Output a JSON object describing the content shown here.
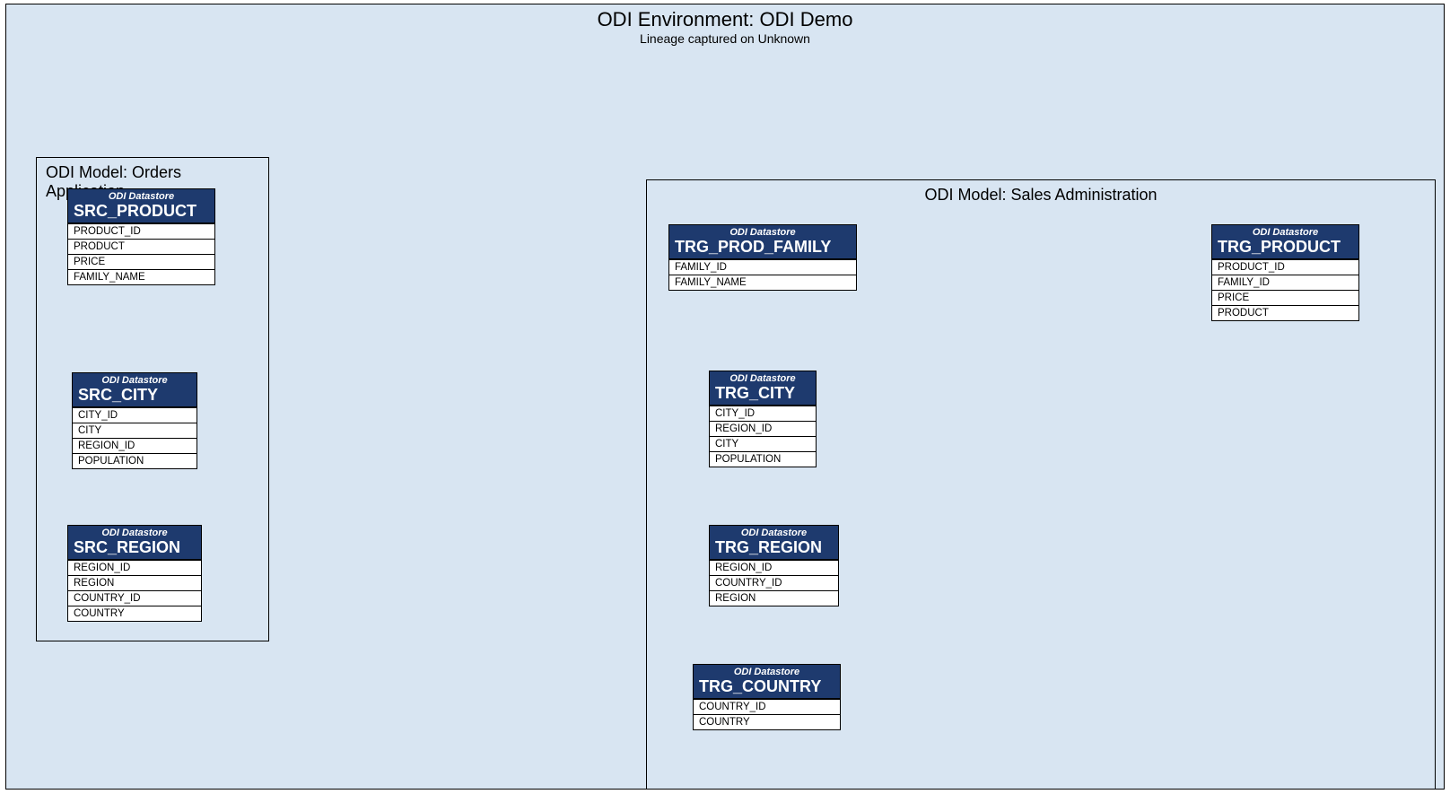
{
  "env": {
    "title": "ODI Environment: ODI Demo",
    "subtitle": "Lineage captured on Unknown"
  },
  "models": {
    "orders": {
      "title": "ODI Model: Orders Application"
    },
    "sales": {
      "title": "ODI Model: Sales Administration"
    }
  },
  "ds_label": "ODI Datastore",
  "tables": {
    "src_product": {
      "name": "SRC_PRODUCT",
      "cols": [
        "PRODUCT_ID",
        "PRODUCT",
        "PRICE",
        "FAMILY_NAME"
      ]
    },
    "src_city": {
      "name": "SRC_CITY",
      "cols": [
        "CITY_ID",
        "CITY",
        "REGION_ID",
        "POPULATION"
      ]
    },
    "src_region": {
      "name": "SRC_REGION",
      "cols": [
        "REGION_ID",
        "REGION",
        "COUNTRY_ID",
        "COUNTRY"
      ]
    },
    "trg_pf": {
      "name": "TRG_PROD_FAMILY",
      "cols": [
        "FAMILY_ID",
        "FAMILY_NAME"
      ]
    },
    "trg_city": {
      "name": "TRG_CITY",
      "cols": [
        "CITY_ID",
        "REGION_ID",
        "CITY",
        "POPULATION"
      ]
    },
    "trg_region": {
      "name": "TRG_REGION",
      "cols": [
        "REGION_ID",
        "COUNTRY_ID",
        "REGION"
      ]
    },
    "trg_country": {
      "name": "TRG_COUNTRY",
      "cols": [
        "COUNTRY_ID",
        "COUNTRY"
      ]
    },
    "trg_product": {
      "name": "TRG_PRODUCT",
      "cols": [
        "PRODUCT_ID",
        "FAMILY_ID",
        "PRICE",
        "PRODUCT"
      ]
    }
  },
  "lineage_solid": [
    [
      "src_product",
      "PRODUCT_ID",
      "trg_product",
      "PRODUCT_ID"
    ],
    [
      "src_product",
      "PRODUCT",
      "trg_product",
      "PRODUCT"
    ],
    [
      "src_product",
      "PRICE",
      "trg_product",
      "PRICE"
    ],
    [
      "src_product",
      "PRODUCT_ID",
      "trg_pf",
      "FAMILY_ID"
    ],
    [
      "src_product",
      "FAMILY_NAME",
      "trg_pf",
      "FAMILY_NAME"
    ],
    [
      "trg_pf",
      "FAMILY_ID",
      "trg_product",
      "FAMILY_ID"
    ],
    [
      "src_city",
      "CITY_ID",
      "trg_city",
      "CITY_ID"
    ],
    [
      "src_city",
      "CITY",
      "trg_city",
      "CITY"
    ],
    [
      "src_city",
      "REGION_ID",
      "trg_city",
      "REGION_ID"
    ],
    [
      "src_city",
      "POPULATION",
      "trg_city",
      "POPULATION"
    ],
    [
      "src_region",
      "REGION_ID",
      "trg_region",
      "REGION_ID"
    ],
    [
      "src_region",
      "REGION",
      "trg_region",
      "REGION"
    ],
    [
      "src_region",
      "COUNTRY_ID",
      "trg_region",
      "COUNTRY_ID"
    ],
    [
      "src_region",
      "COUNTRY_ID",
      "trg_country",
      "COUNTRY_ID"
    ],
    [
      "src_region",
      "COUNTRY",
      "trg_country",
      "COUNTRY"
    ]
  ],
  "lineage_dashed_out": [
    [
      "trg_pf",
      "FAMILY_ID"
    ],
    [
      "trg_pf",
      "FAMILY_NAME"
    ],
    [
      "trg_city",
      "CITY_ID"
    ],
    [
      "trg_city",
      "REGION_ID"
    ],
    [
      "trg_city",
      "CITY"
    ],
    [
      "trg_city",
      "POPULATION"
    ],
    [
      "trg_region",
      "REGION_ID"
    ],
    [
      "trg_region",
      "COUNTRY_ID"
    ],
    [
      "trg_region",
      "REGION"
    ],
    [
      "trg_country",
      "COUNTRY_ID"
    ],
    [
      "trg_country",
      "COUNTRY"
    ],
    [
      "trg_product",
      "PRODUCT_ID"
    ],
    [
      "trg_product",
      "FAMILY_ID"
    ],
    [
      "trg_product",
      "PRICE"
    ],
    [
      "trg_product",
      "PRODUCT"
    ]
  ]
}
